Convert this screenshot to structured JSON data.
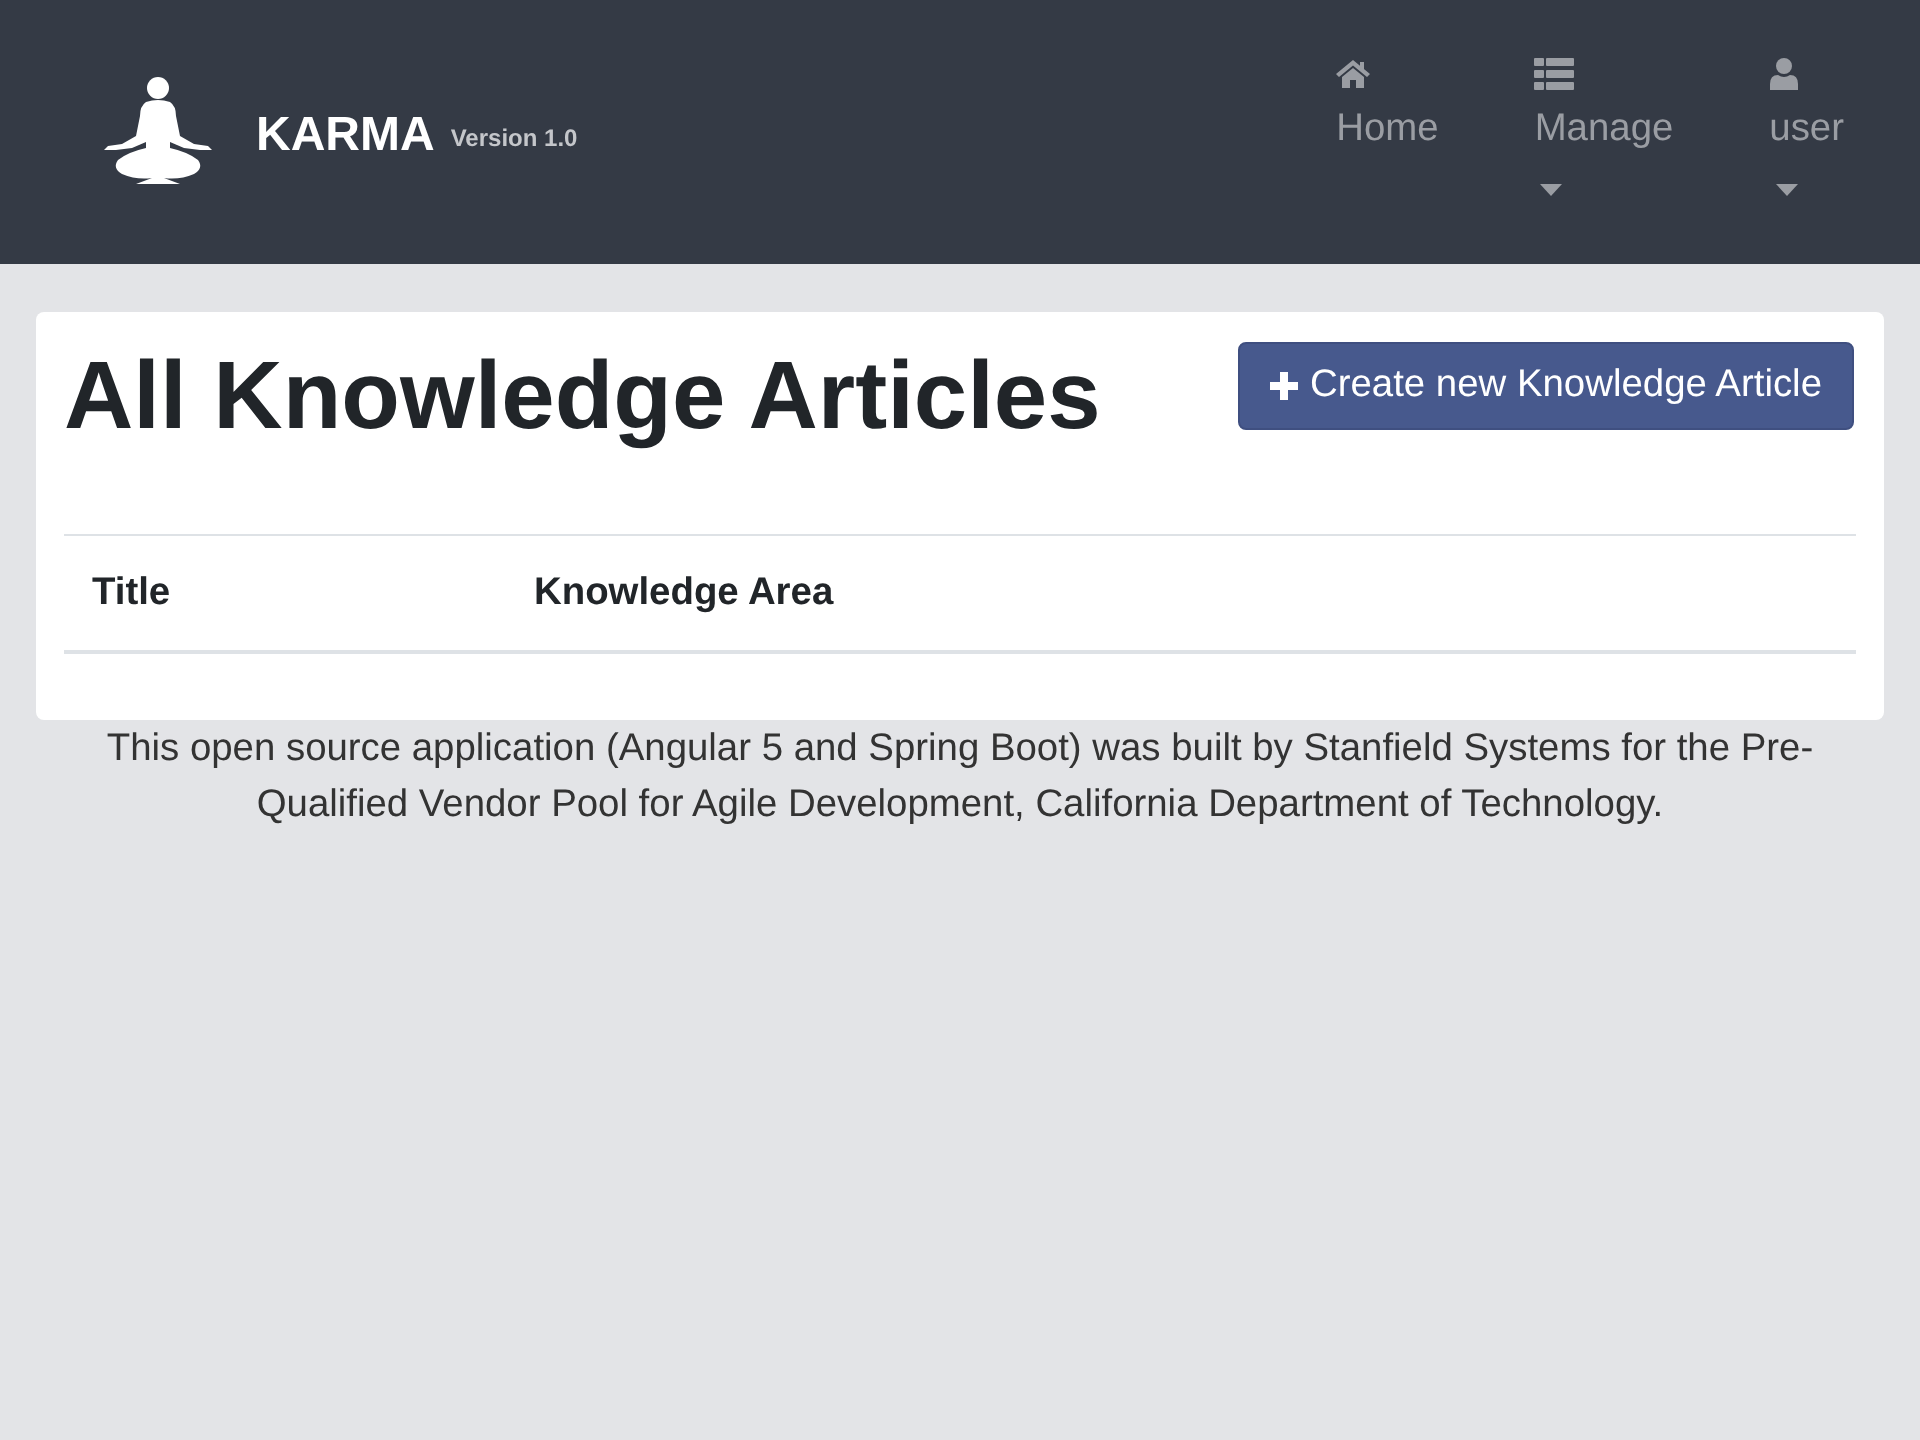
{
  "header": {
    "brand": {
      "name": "KARMA",
      "version": "Version 1.0"
    },
    "nav": [
      {
        "label": "Home",
        "has_menu": false
      },
      {
        "label": "Manage",
        "has_menu": true
      },
      {
        "label": "user",
        "has_menu": true
      }
    ]
  },
  "page": {
    "title": "All Knowledge Articles",
    "create_button": "Create new Knowledge Article"
  },
  "table": {
    "columns": [
      "Title",
      "Knowledge Area"
    ]
  },
  "footer": {
    "text": "This open source application (Angular 5 and Spring Boot) was built by Stanfield Systems for the Pre-Qualified Vendor Pool for Agile Development, California Department of Technology."
  }
}
